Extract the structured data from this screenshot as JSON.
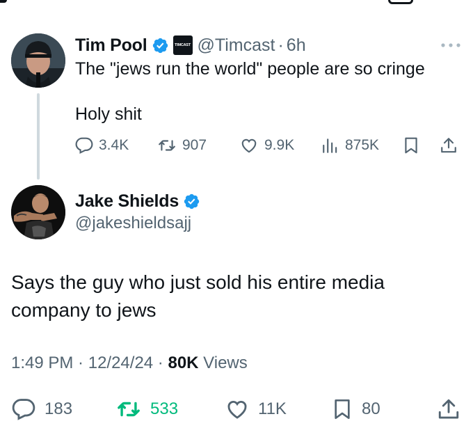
{
  "parent_tweet": {
    "display_name": "Tim Pool",
    "affiliate_badge_text": "TIMCAST",
    "handle": "@Timcast",
    "separator": "·",
    "time": "6h",
    "text_line1": "The \"jews run the world\" people are so cringe",
    "text_line2": "Holy shit",
    "actions": {
      "replies": "3.4K",
      "reposts": "907",
      "likes": "9.9K",
      "views": "875K"
    }
  },
  "reply_tweet": {
    "display_name": "Jake Shields",
    "handle": "@jakeshieldsajj",
    "text": "Says the guy who just sold his entire media company to jews",
    "meta": {
      "time": "1:49 PM",
      "sep1": " · ",
      "date": "12/24/24",
      "sep2": " · ",
      "views_count": "80K",
      "views_label": " Views"
    },
    "actions": {
      "replies": "183",
      "reposts": "533",
      "likes": "11K",
      "bookmarks": "80"
    }
  },
  "colors": {
    "verified_blue": "#1d9bf0",
    "secondary_text": "#536471",
    "primary_text": "#0f1419",
    "repost_green": "#00ba7c",
    "thread_line": "#cfd9de"
  }
}
